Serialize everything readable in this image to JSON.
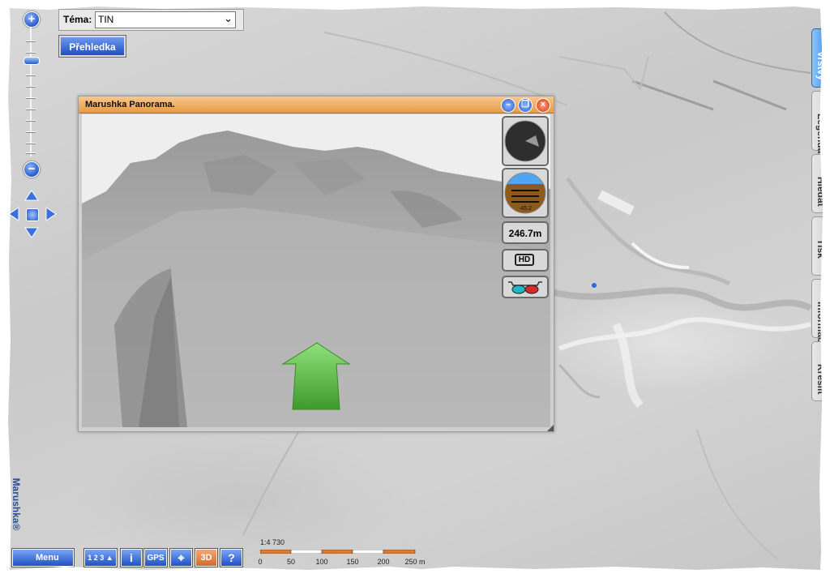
{
  "theme": {
    "label": "Téma:",
    "value": "TIN"
  },
  "overview_button": "Přehledka",
  "panorama": {
    "title": "Marushka Panorama.",
    "tilt_value": "-45.2",
    "distance": "246.7m",
    "hd_label": "HD"
  },
  "tabs": [
    "Vrstvy",
    "Legenda",
    "Hledat",
    "Tisk",
    "Informace",
    "Kreslit"
  ],
  "active_tab": "Vrstvy",
  "brand": "Marushka®",
  "toolbar": {
    "menu": "Menu",
    "info": "i",
    "gps": "GPS",
    "three_d": "3D",
    "help": "?",
    "measure": "1 2 3"
  },
  "scale": {
    "ratio": "1:4 730",
    "labels": [
      "0",
      "50",
      "100",
      "150",
      "200",
      "250 m"
    ]
  },
  "colors": {
    "accent": "#2a5cc8",
    "title_bar": "#e89a45",
    "scale": "#e07a30"
  }
}
